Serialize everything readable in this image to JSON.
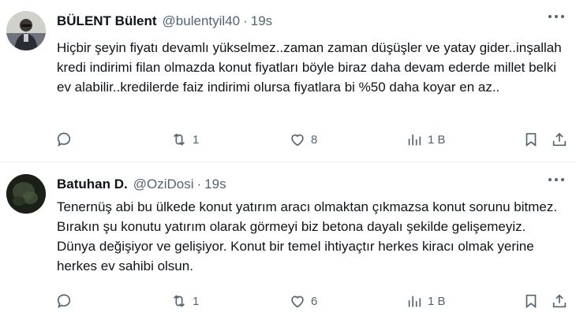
{
  "tweets": [
    {
      "name": "BÜLENT Bülent",
      "handle": "@bulentyil40",
      "separator": "·",
      "time": "19s",
      "text": "Hiçbir şeyin fiyatı devamlı yükselmez..zaman zaman düşüşler ve yatay gider..inşallah kredi indirimi filan olmazda konut fiyatları böyle biraz daha devam ederde millet belki ev alabilir..kredilerde faiz indirimi olursa fiyatlara bi %50 daha koyar en az..",
      "retweets": "1",
      "likes": "8",
      "views": "1 B",
      "icons": [
        "reply-icon",
        "retweet-icon",
        "heart-icon",
        "views-icon",
        "bookmark-icon",
        "share-icon",
        "more-icon"
      ]
    },
    {
      "name": "Batuhan D.",
      "handle": "@OziDosi",
      "separator": "·",
      "time": "19s",
      "text": "Tenernüş abi bu ülkede konut yatırım aracı olmaktan çıkmazsa konut sorunu bitmez. Bırakın şu konutu yatırım olarak görmeyi biz betona dayalı şekilde gelişemeyiz. Dünya değişiyor ve gelişiyor. Konut bir temel ihtiyaçtır herkes kiracı olmak yerine herkes ev sahibi olsun.",
      "retweets": "1",
      "likes": "6",
      "views": "1 B",
      "icons": [
        "reply-icon",
        "retweet-icon",
        "heart-icon",
        "views-icon",
        "bookmark-icon",
        "share-icon",
        "more-icon"
      ]
    }
  ],
  "colors": {
    "text": "#0f1419",
    "secondary": "#536471",
    "divider": "#eff3f4"
  }
}
